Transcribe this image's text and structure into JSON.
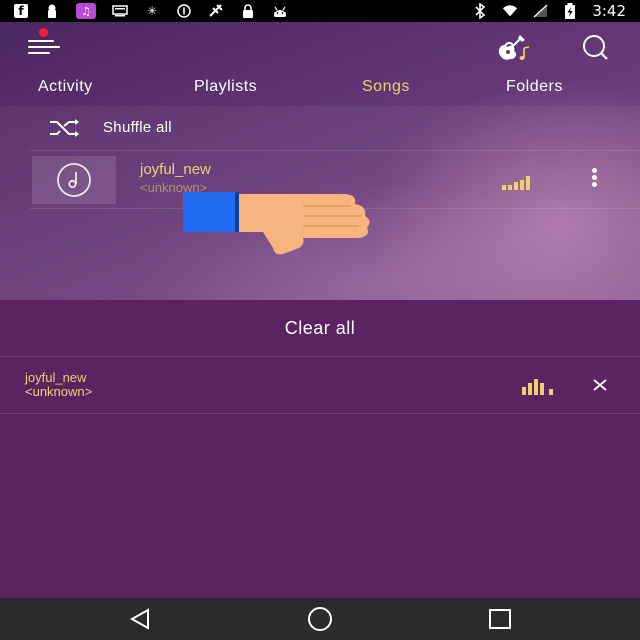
{
  "status_bar": {
    "time": "3:42",
    "left_icons": [
      "facebook-icon",
      "lock-keyhole-icon",
      "music-note-icon",
      "message-icon",
      "brightness-icon",
      "info-icon",
      "satellite-icon",
      "lock-icon",
      "android-icon"
    ],
    "right_icons": [
      "bluetooth-icon",
      "wifi-icon",
      "signal-icon",
      "battery-charging-icon"
    ]
  },
  "header": {
    "menu_icon": "menu-icon",
    "notification_dot_color": "#ff1b3c",
    "guitar_icon": "guitar-icon",
    "search_icon": "search-icon"
  },
  "tabs": [
    {
      "label": "Activity",
      "active": false
    },
    {
      "label": "Playlists",
      "active": false
    },
    {
      "label": "Songs",
      "active": true
    },
    {
      "label": "Folders",
      "active": false
    }
  ],
  "shuffle": {
    "label": "Shuffle all",
    "icon": "shuffle-icon"
  },
  "songs": [
    {
      "title": "joyful_new",
      "artist": "<unknown>",
      "thumb_icon": "music-disc-icon",
      "playing": true
    }
  ],
  "queue": {
    "clear_label": "Clear all",
    "items": [
      {
        "title": "joyful_new",
        "artist": "<unknown>",
        "playing": true
      }
    ]
  },
  "colors": {
    "accent": "#f2cf6e",
    "queue_background": "#5b2361",
    "status_bar": "#000000",
    "nav_bar": "#2b2b2e"
  },
  "nav_bar": {
    "icons": [
      "back-icon",
      "home-icon",
      "recents-icon"
    ]
  }
}
